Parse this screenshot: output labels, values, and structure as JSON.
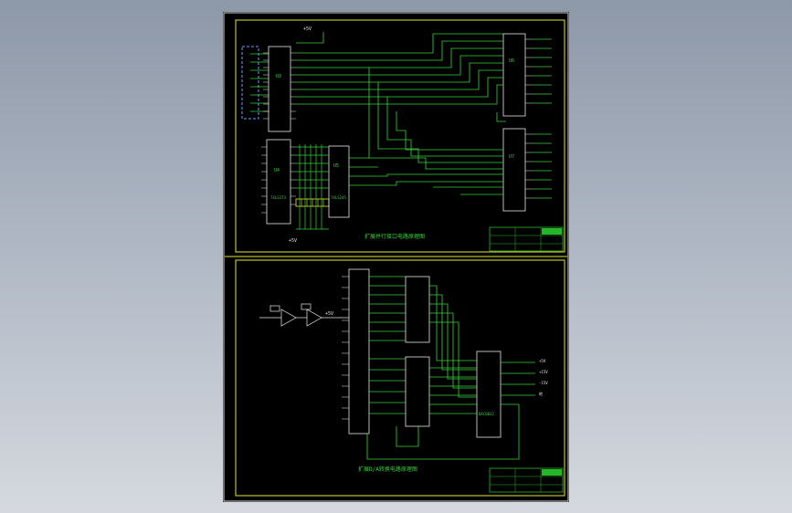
{
  "drawing": {
    "top_supply": "+5V",
    "top_caption": "扩展并行接口电路原理图",
    "bottom_caption": "扩展D/A转换电路原理图",
    "top_bus_supply": "+5V",
    "bottom_supply": "+5V",
    "rail_labels": [
      "+5V",
      "+15V",
      "-15V",
      "地"
    ],
    "chips": {
      "u3": "U3",
      "u4": "U4",
      "u5": "U5",
      "u6": "U6",
      "u7": "U7",
      "dac": "DAC0832",
      "latch": "74LS373",
      "buffer": "74LS245"
    }
  },
  "colors": {
    "background": "#000000",
    "wire_green": "#37d23a",
    "frame_yellow": "#e6e632",
    "pin_white": "#e8e8e8",
    "title_block": "#28b428"
  }
}
